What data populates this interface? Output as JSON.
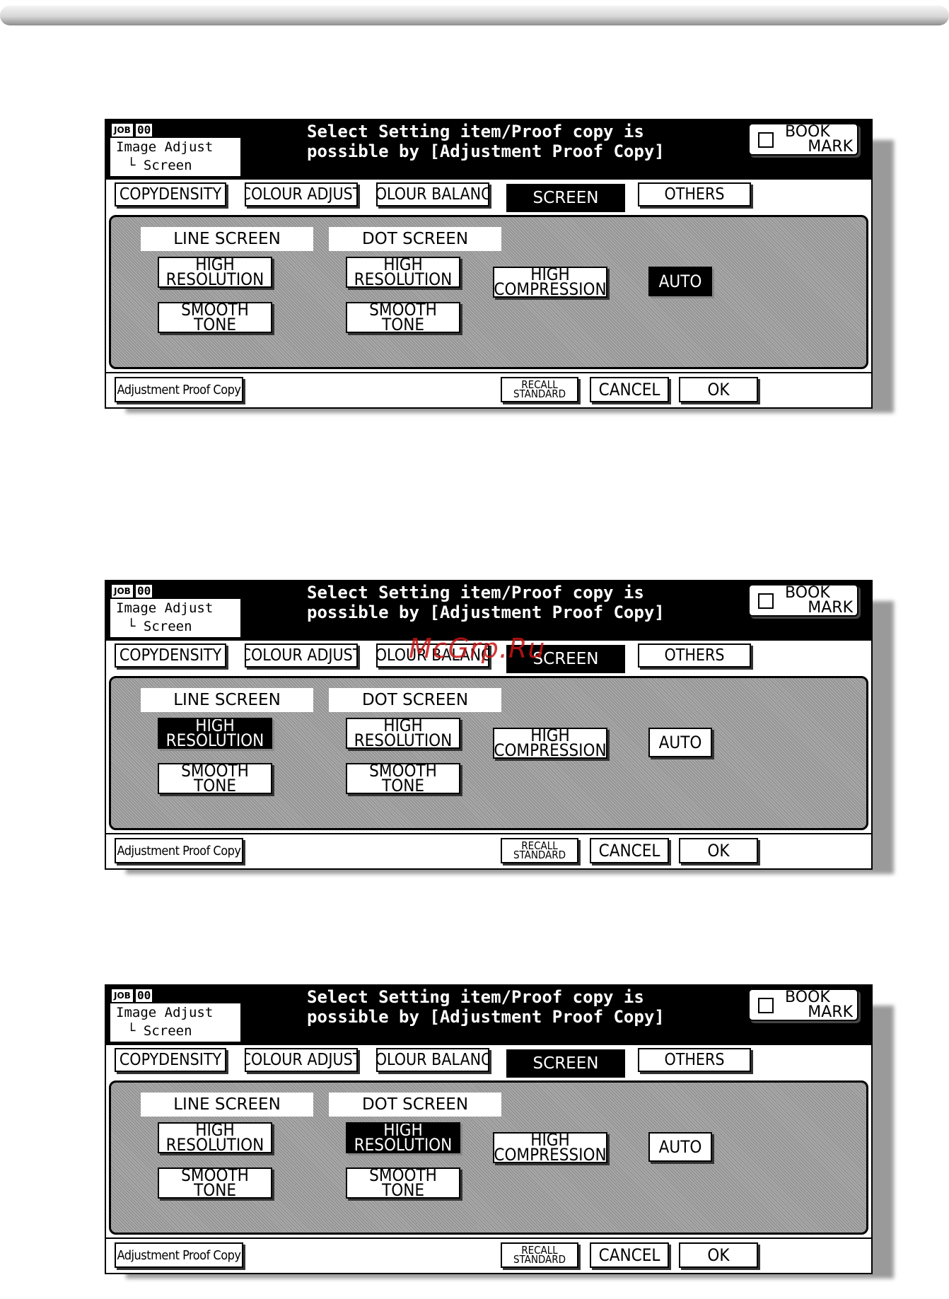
{
  "screens": [
    {
      "job_label": "JOB",
      "job_number": "00",
      "location": {
        "line1": "Image Adjust",
        "line2": "└ Screen"
      },
      "message": {
        "line1": "Select Setting item/Proof copy is",
        "line2": "possible by [Adjustment Proof Copy]"
      },
      "bookmark": {
        "line1": "BOOK",
        "line2": "MARK"
      },
      "tabs": [
        "COPYDENSITY",
        "COLOUR ADJUST",
        "COLOUR BALANCE",
        "SCREEN",
        "OTHERS"
      ],
      "line_screen_label": "LINE SCREEN",
      "dot_screen_label": "DOT SCREEN",
      "buttons": {
        "line_high": {
          "line1": "HIGH",
          "line2": "RESOLUTION"
        },
        "line_smooth": {
          "line1": "SMOOTH",
          "line2": "TONE"
        },
        "dot_high": {
          "line1": "HIGH",
          "line2": "RESOLUTION"
        },
        "dot_smooth": {
          "line1": "SMOOTH",
          "line2": "TONE"
        },
        "high_compression": {
          "line1": "HIGH",
          "line2": "COMPRESSION"
        },
        "auto": "AUTO"
      },
      "selected": "auto",
      "footer": {
        "proof": "Adjustment Proof Copy",
        "recall_1": "RECALL",
        "recall_2": "STANDARD",
        "cancel": "CANCEL",
        "ok": "OK"
      }
    },
    {
      "job_label": "JOB",
      "job_number": "00",
      "location": {
        "line1": "Image Adjust",
        "line2": "└ Screen"
      },
      "message": {
        "line1": "Select Setting item/Proof copy is",
        "line2": "possible by [Adjustment Proof Copy]"
      },
      "bookmark": {
        "line1": "BOOK",
        "line2": "MARK"
      },
      "tabs": [
        "COPYDENSITY",
        "COLOUR ADJUST",
        "COLOUR BALANCE",
        "SCREEN",
        "OTHERS"
      ],
      "line_screen_label": "LINE SCREEN",
      "dot_screen_label": "DOT SCREEN",
      "buttons": {
        "line_high": {
          "line1": "HIGH",
          "line2": "RESOLUTION"
        },
        "line_smooth": {
          "line1": "SMOOTH",
          "line2": "TONE"
        },
        "dot_high": {
          "line1": "HIGH",
          "line2": "RESOLUTION"
        },
        "dot_smooth": {
          "line1": "SMOOTH",
          "line2": "TONE"
        },
        "high_compression": {
          "line1": "HIGH",
          "line2": "COMPRESSION"
        },
        "auto": "AUTO"
      },
      "selected": "line_high",
      "footer": {
        "proof": "Adjustment Proof Copy",
        "recall_1": "RECALL",
        "recall_2": "STANDARD",
        "cancel": "CANCEL",
        "ok": "OK"
      }
    },
    {
      "job_label": "JOB",
      "job_number": "00",
      "location": {
        "line1": "Image Adjust",
        "line2": "└ Screen"
      },
      "message": {
        "line1": "Select Setting item/Proof copy is",
        "line2": "possible by [Adjustment Proof Copy]"
      },
      "bookmark": {
        "line1": "BOOK",
        "line2": "MARK"
      },
      "tabs": [
        "COPYDENSITY",
        "COLOUR ADJUST",
        "COLOUR BALANCE",
        "SCREEN",
        "OTHERS"
      ],
      "line_screen_label": "LINE SCREEN",
      "dot_screen_label": "DOT SCREEN",
      "buttons": {
        "line_high": {
          "line1": "HIGH",
          "line2": "RESOLUTION"
        },
        "line_smooth": {
          "line1": "SMOOTH",
          "line2": "TONE"
        },
        "dot_high": {
          "line1": "HIGH",
          "line2": "RESOLUTION"
        },
        "dot_smooth": {
          "line1": "SMOOTH",
          "line2": "TONE"
        },
        "high_compression": {
          "line1": "HIGH",
          "line2": "COMPRESSION"
        },
        "auto": "AUTO"
      },
      "selected": "dot_high",
      "footer": {
        "proof": "Adjustment Proof Copy",
        "recall_1": "RECALL",
        "recall_2": "STANDARD",
        "cancel": "CANCEL",
        "ok": "OK"
      }
    }
  ],
  "watermark": "McGrp.Ru"
}
